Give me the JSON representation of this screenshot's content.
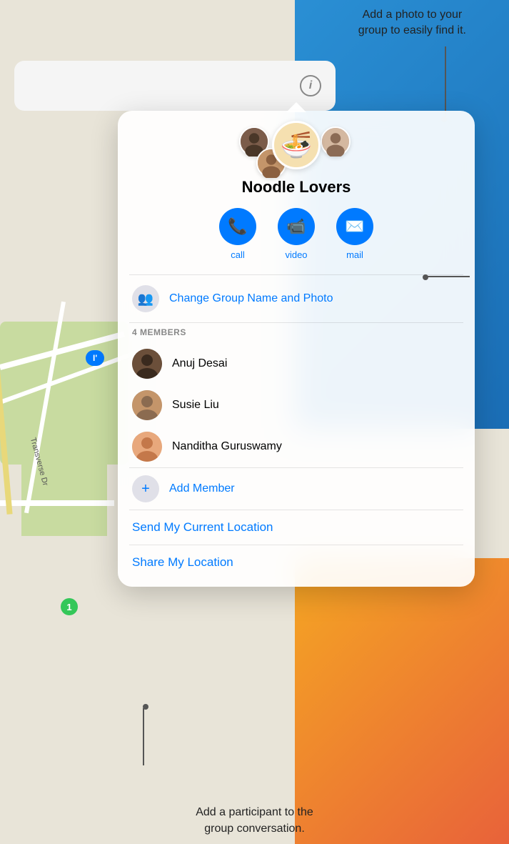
{
  "tooltip_top_line1": "Add a photo to your",
  "tooltip_top_line2": "group to easily find it.",
  "tooltip_bottom_line1": "Add a participant to the",
  "tooltip_bottom_line2": "group conversation.",
  "info_icon_label": "i",
  "group": {
    "name": "Noodle Lovers",
    "emoji": "🍜"
  },
  "actions": [
    {
      "id": "call",
      "icon": "📞",
      "label": "call"
    },
    {
      "id": "video",
      "icon": "📹",
      "label": "video"
    },
    {
      "id": "mail",
      "icon": "✉️",
      "label": "mail"
    }
  ],
  "change_group": {
    "icon": "👥",
    "text": "Change Group Name and Photo"
  },
  "members_header": "4 MEMBERS",
  "members": [
    {
      "id": "anuj",
      "name": "Anuj Desai",
      "color": "anuj"
    },
    {
      "id": "susie",
      "name": "Susie Liu",
      "color": "susie"
    },
    {
      "id": "nanditha",
      "name": "Nanditha Guruswamy",
      "color": "nanditha"
    }
  ],
  "add_member": {
    "icon": "+",
    "text": "Add Member"
  },
  "location_actions": [
    {
      "id": "send-location",
      "text": "Send My Current Location"
    },
    {
      "id": "share-location",
      "text": "Share My Location"
    }
  ],
  "map": {
    "road_label": "Transverse Dr",
    "green_marker": "1",
    "blue_badge": "I'"
  }
}
